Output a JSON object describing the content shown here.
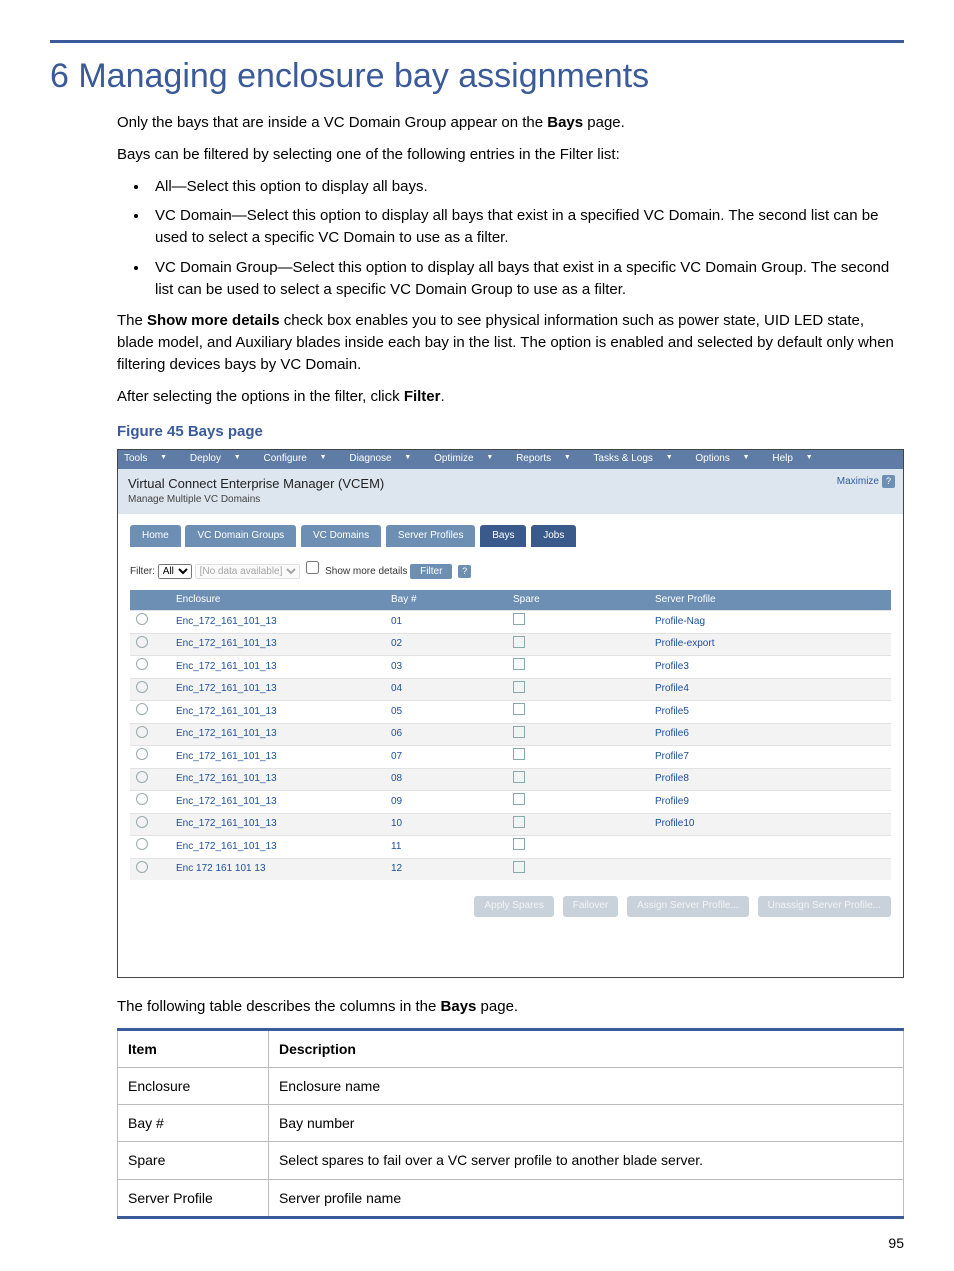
{
  "heading": "6 Managing enclosure bay assignments",
  "para1_before": "Only the bays that are inside a VC Domain Group appear on the ",
  "bays_word": "Bays",
  "para1_after": " page.",
  "para2": "Bays can be filtered by selecting one of the following entries in the Filter list:",
  "bullets": [
    "All—Select this option to display all bays.",
    "VC Domain—Select this option to display all bays that exist in a specified VC Domain. The second list can be used to select a specific VC Domain to use as a filter.",
    "VC Domain Group—Select this option to display all bays that exist in a specific VC Domain Group. The second list can be used to select a specific VC Domain Group to use as a filter."
  ],
  "para3_before": "The ",
  "show_more": "Show more details",
  "para3_after": " check box enables you to see physical information such as power state, UID LED state, blade model, and Auxiliary blades inside each bay in the list. The option is enabled and selected by default only when filtering devices bays by VC Domain.",
  "para4_before": "After selecting the options in the filter, click ",
  "filter_word": "Filter",
  "para4_after": ".",
  "figcaption": "Figure 45 Bays page",
  "screenshot": {
    "menu": [
      "Tools",
      "Deploy",
      "Configure",
      "Diagnose",
      "Optimize",
      "Reports",
      "Tasks & Logs",
      "Options",
      "Help"
    ],
    "title": "Virtual Connect Enterprise Manager (VCEM)",
    "subtitle": "Manage Multiple VC Domains",
    "maximize": "Maximize",
    "tabs": [
      {
        "label": "Home",
        "active": false
      },
      {
        "label": "VC Domain Groups",
        "active": false
      },
      {
        "label": "VC Domains",
        "active": false
      },
      {
        "label": "Server Profiles",
        "active": false
      },
      {
        "label": "Bays",
        "active": true
      },
      {
        "label": "Jobs",
        "active": true
      }
    ],
    "filter_label": "Filter:",
    "filter_value": "All",
    "filter_second": "[No data available]",
    "show_more_label": "Show more details",
    "filter_btn": "Filter",
    "grid_headers": [
      "",
      "Enclosure",
      "Bay #",
      "Spare",
      "Server Profile"
    ],
    "rows": [
      {
        "enc": "Enc_172_161_101_13",
        "bay": "01",
        "profile": "Profile-Nag"
      },
      {
        "enc": "Enc_172_161_101_13",
        "bay": "02",
        "profile": "Profile-export"
      },
      {
        "enc": "Enc_172_161_101_13",
        "bay": "03",
        "profile": "Profile3"
      },
      {
        "enc": "Enc_172_161_101_13",
        "bay": "04",
        "profile": "Profile4"
      },
      {
        "enc": "Enc_172_161_101_13",
        "bay": "05",
        "profile": "Profile5"
      },
      {
        "enc": "Enc_172_161_101_13",
        "bay": "06",
        "profile": "Profile6"
      },
      {
        "enc": "Enc_172_161_101_13",
        "bay": "07",
        "profile": "Profile7"
      },
      {
        "enc": "Enc_172_161_101_13",
        "bay": "08",
        "profile": "Profile8"
      },
      {
        "enc": "Enc_172_161_101_13",
        "bay": "09",
        "profile": "Profile9"
      },
      {
        "enc": "Enc_172_161_101_13",
        "bay": "10",
        "profile": "Profile10"
      },
      {
        "enc": "Enc_172_161_101_13",
        "bay": "11",
        "profile": ""
      },
      {
        "enc": "Enc 172 161 101 13",
        "bay": "12",
        "profile": ""
      }
    ],
    "actions": [
      "Apply Spares",
      "Failover",
      "Assign Server Profile...",
      "Unassign Server Profile..."
    ]
  },
  "table_intro_before": "The following table describes the columns in the ",
  "table_intro_after": " page.",
  "desc_table": {
    "headers": [
      "Item",
      "Description"
    ],
    "rows": [
      [
        "Enclosure",
        "Enclosure name"
      ],
      [
        "Bay #",
        "Bay number"
      ],
      [
        "Spare",
        "Select spares to fail over a VC server profile to another blade server."
      ],
      [
        "Server Profile",
        "Server profile name"
      ]
    ]
  },
  "page_number": "95"
}
